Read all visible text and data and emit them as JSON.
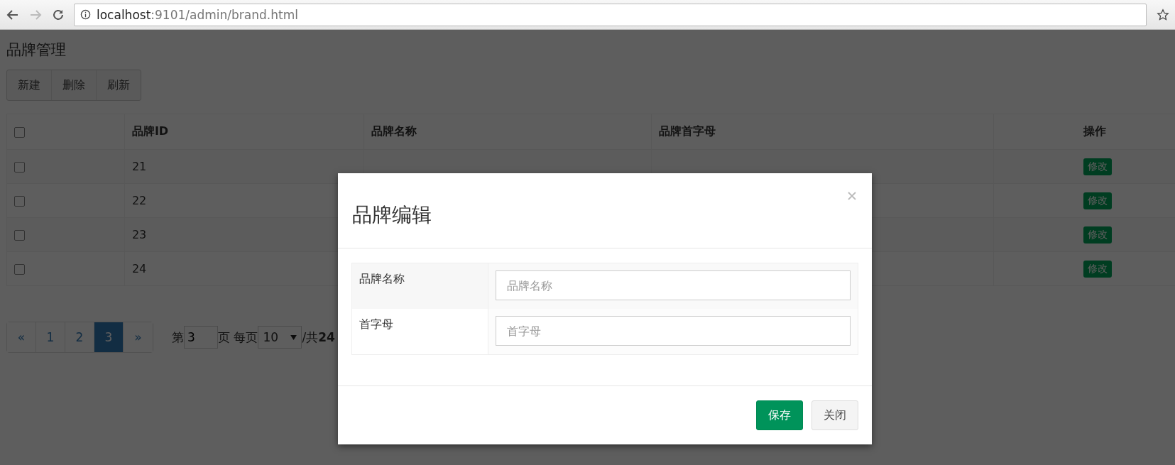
{
  "browser": {
    "url_host": "localhost",
    "url_path": ":9101/admin/brand.html"
  },
  "page_title": "品牌管理",
  "toolbar": [
    "新建",
    "删除",
    "刷新"
  ],
  "table": {
    "header_checked": false,
    "columns": [
      "品牌ID",
      "品牌名称",
      "品牌首字母",
      "操作"
    ],
    "rows": [
      {
        "checked": false,
        "id": "21",
        "action": "修改"
      },
      {
        "checked": false,
        "id": "22",
        "action": "修改"
      },
      {
        "checked": false,
        "id": "23",
        "action": "修改"
      },
      {
        "checked": false,
        "id": "24",
        "action": "修改"
      }
    ]
  },
  "pagination": {
    "pages": [
      {
        "label": "«",
        "selected": false
      },
      {
        "label": "1",
        "selected": false
      },
      {
        "label": "2",
        "selected": false
      },
      {
        "label": "3",
        "selected": true
      },
      {
        "label": "»",
        "selected": false
      }
    ],
    "prefix": "第",
    "page_value": "3",
    "middle": "页 每页",
    "page_size": "10",
    "total": "/共**24**"
  },
  "modal": {
    "title": "品牌编辑",
    "fields": [
      {
        "label": "品牌名称",
        "placeholder": "品牌名称"
      },
      {
        "label": "首字母",
        "placeholder": "首字母"
      }
    ],
    "buttons": [
      {
        "label": "保存",
        "kind": "primary"
      },
      {
        "label": "关闭",
        "kind": "default"
      }
    ]
  }
}
